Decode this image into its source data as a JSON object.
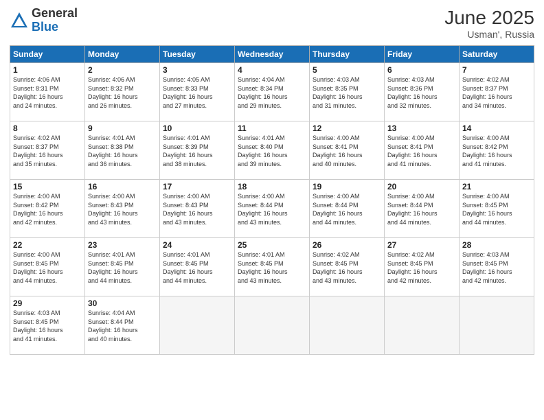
{
  "header": {
    "logo_general": "General",
    "logo_blue": "Blue",
    "month_title": "June 2025",
    "location": "Usman', Russia"
  },
  "days_of_week": [
    "Sunday",
    "Monday",
    "Tuesday",
    "Wednesday",
    "Thursday",
    "Friday",
    "Saturday"
  ],
  "weeks": [
    [
      {
        "day": 1,
        "lines": [
          "Sunrise: 4:06 AM",
          "Sunset: 8:31 PM",
          "Daylight: 16 hours",
          "and 24 minutes."
        ]
      },
      {
        "day": 2,
        "lines": [
          "Sunrise: 4:06 AM",
          "Sunset: 8:32 PM",
          "Daylight: 16 hours",
          "and 26 minutes."
        ]
      },
      {
        "day": 3,
        "lines": [
          "Sunrise: 4:05 AM",
          "Sunset: 8:33 PM",
          "Daylight: 16 hours",
          "and 27 minutes."
        ]
      },
      {
        "day": 4,
        "lines": [
          "Sunrise: 4:04 AM",
          "Sunset: 8:34 PM",
          "Daylight: 16 hours",
          "and 29 minutes."
        ]
      },
      {
        "day": 5,
        "lines": [
          "Sunrise: 4:03 AM",
          "Sunset: 8:35 PM",
          "Daylight: 16 hours",
          "and 31 minutes."
        ]
      },
      {
        "day": 6,
        "lines": [
          "Sunrise: 4:03 AM",
          "Sunset: 8:36 PM",
          "Daylight: 16 hours",
          "and 32 minutes."
        ]
      },
      {
        "day": 7,
        "lines": [
          "Sunrise: 4:02 AM",
          "Sunset: 8:37 PM",
          "Daylight: 16 hours",
          "and 34 minutes."
        ]
      }
    ],
    [
      {
        "day": 8,
        "lines": [
          "Sunrise: 4:02 AM",
          "Sunset: 8:37 PM",
          "Daylight: 16 hours",
          "and 35 minutes."
        ]
      },
      {
        "day": 9,
        "lines": [
          "Sunrise: 4:01 AM",
          "Sunset: 8:38 PM",
          "Daylight: 16 hours",
          "and 36 minutes."
        ]
      },
      {
        "day": 10,
        "lines": [
          "Sunrise: 4:01 AM",
          "Sunset: 8:39 PM",
          "Daylight: 16 hours",
          "and 38 minutes."
        ]
      },
      {
        "day": 11,
        "lines": [
          "Sunrise: 4:01 AM",
          "Sunset: 8:40 PM",
          "Daylight: 16 hours",
          "and 39 minutes."
        ]
      },
      {
        "day": 12,
        "lines": [
          "Sunrise: 4:00 AM",
          "Sunset: 8:41 PM",
          "Daylight: 16 hours",
          "and 40 minutes."
        ]
      },
      {
        "day": 13,
        "lines": [
          "Sunrise: 4:00 AM",
          "Sunset: 8:41 PM",
          "Daylight: 16 hours",
          "and 41 minutes."
        ]
      },
      {
        "day": 14,
        "lines": [
          "Sunrise: 4:00 AM",
          "Sunset: 8:42 PM",
          "Daylight: 16 hours",
          "and 41 minutes."
        ]
      }
    ],
    [
      {
        "day": 15,
        "lines": [
          "Sunrise: 4:00 AM",
          "Sunset: 8:42 PM",
          "Daylight: 16 hours",
          "and 42 minutes."
        ]
      },
      {
        "day": 16,
        "lines": [
          "Sunrise: 4:00 AM",
          "Sunset: 8:43 PM",
          "Daylight: 16 hours",
          "and 43 minutes."
        ]
      },
      {
        "day": 17,
        "lines": [
          "Sunrise: 4:00 AM",
          "Sunset: 8:43 PM",
          "Daylight: 16 hours",
          "and 43 minutes."
        ]
      },
      {
        "day": 18,
        "lines": [
          "Sunrise: 4:00 AM",
          "Sunset: 8:44 PM",
          "Daylight: 16 hours",
          "and 43 minutes."
        ]
      },
      {
        "day": 19,
        "lines": [
          "Sunrise: 4:00 AM",
          "Sunset: 8:44 PM",
          "Daylight: 16 hours",
          "and 44 minutes."
        ]
      },
      {
        "day": 20,
        "lines": [
          "Sunrise: 4:00 AM",
          "Sunset: 8:44 PM",
          "Daylight: 16 hours",
          "and 44 minutes."
        ]
      },
      {
        "day": 21,
        "lines": [
          "Sunrise: 4:00 AM",
          "Sunset: 8:45 PM",
          "Daylight: 16 hours",
          "and 44 minutes."
        ]
      }
    ],
    [
      {
        "day": 22,
        "lines": [
          "Sunrise: 4:00 AM",
          "Sunset: 8:45 PM",
          "Daylight: 16 hours",
          "and 44 minutes."
        ]
      },
      {
        "day": 23,
        "lines": [
          "Sunrise: 4:01 AM",
          "Sunset: 8:45 PM",
          "Daylight: 16 hours",
          "and 44 minutes."
        ]
      },
      {
        "day": 24,
        "lines": [
          "Sunrise: 4:01 AM",
          "Sunset: 8:45 PM",
          "Daylight: 16 hours",
          "and 44 minutes."
        ]
      },
      {
        "day": 25,
        "lines": [
          "Sunrise: 4:01 AM",
          "Sunset: 8:45 PM",
          "Daylight: 16 hours",
          "and 43 minutes."
        ]
      },
      {
        "day": 26,
        "lines": [
          "Sunrise: 4:02 AM",
          "Sunset: 8:45 PM",
          "Daylight: 16 hours",
          "and 43 minutes."
        ]
      },
      {
        "day": 27,
        "lines": [
          "Sunrise: 4:02 AM",
          "Sunset: 8:45 PM",
          "Daylight: 16 hours",
          "and 42 minutes."
        ]
      },
      {
        "day": 28,
        "lines": [
          "Sunrise: 4:03 AM",
          "Sunset: 8:45 PM",
          "Daylight: 16 hours",
          "and 42 minutes."
        ]
      }
    ],
    [
      {
        "day": 29,
        "lines": [
          "Sunrise: 4:03 AM",
          "Sunset: 8:45 PM",
          "Daylight: 16 hours",
          "and 41 minutes."
        ]
      },
      {
        "day": 30,
        "lines": [
          "Sunrise: 4:04 AM",
          "Sunset: 8:44 PM",
          "Daylight: 16 hours",
          "and 40 minutes."
        ]
      },
      null,
      null,
      null,
      null,
      null
    ]
  ]
}
